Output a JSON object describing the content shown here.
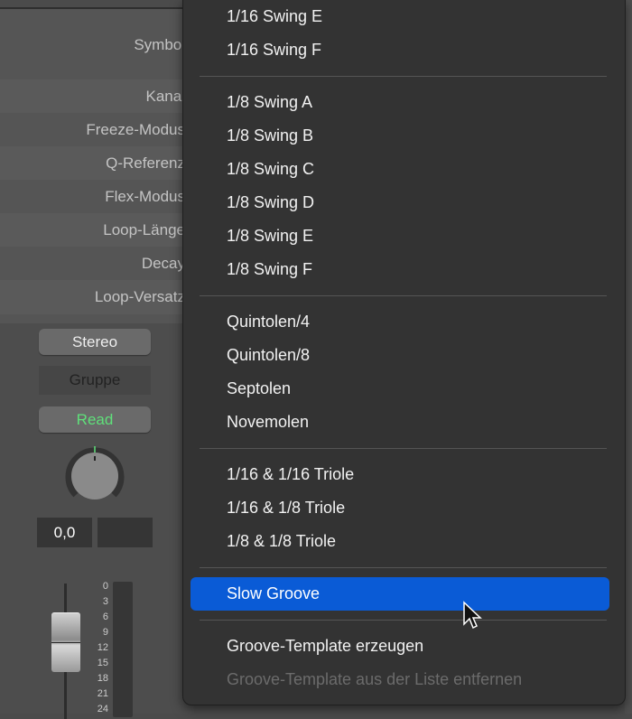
{
  "inspector": {
    "rows": [
      "Symbol",
      "Kanal",
      "Freeze-Modus",
      "Q-Referenz",
      "Flex-Modus",
      "Loop-Länge",
      "Decay",
      "Loop-Versatz"
    ]
  },
  "channel_strip": {
    "stereo_button": "Stereo",
    "group_button": "Gruppe",
    "automation_button": "Read",
    "automation_color": "#5fe07a",
    "pan_value": "0,0",
    "meter_scale": [
      "0",
      "3",
      "6",
      "9",
      "12",
      "15",
      "18",
      "21",
      "24"
    ]
  },
  "menu": {
    "groups": [
      [
        "1/16 Swing E",
        "1/16 Swing F"
      ],
      [
        "1/8 Swing A",
        "1/8 Swing B",
        "1/8 Swing C",
        "1/8 Swing D",
        "1/8 Swing E",
        "1/8 Swing F"
      ],
      [
        "Quintolen/4",
        "Quintolen/8",
        "Septolen",
        "Novemolen"
      ],
      [
        "1/16 & 1/16 Triole",
        "1/16 & 1/8 Triole",
        "1/8 & 1/8 Triole"
      ],
      [
        "Slow Groove"
      ],
      [
        "Groove-Template erzeugen",
        "Groove-Template aus der Liste entfernen"
      ]
    ],
    "selected": "Slow Groove",
    "disabled": [
      "Groove-Template aus der Liste entfernen"
    ],
    "highlight_color": "#0a5bd6"
  }
}
